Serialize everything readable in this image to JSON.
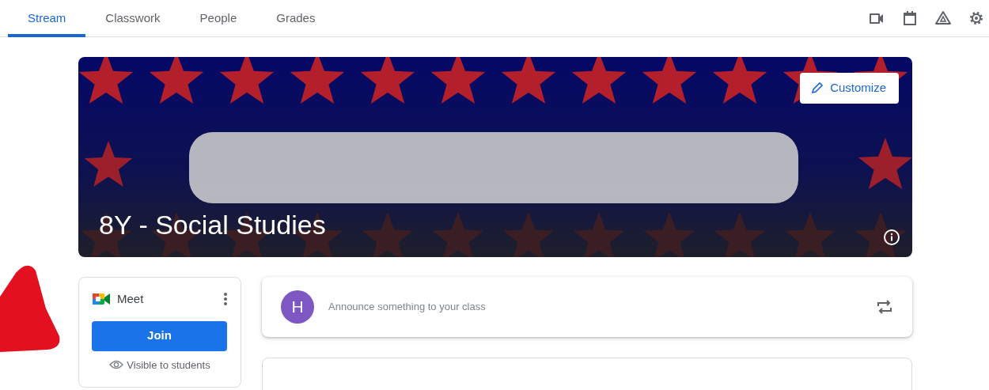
{
  "tabs": [
    {
      "label": "Stream",
      "selected": true
    },
    {
      "label": "Classwork",
      "selected": false
    },
    {
      "label": "People",
      "selected": false
    },
    {
      "label": "Grades",
      "selected": false
    }
  ],
  "toolbar": [
    {
      "kind": "video"
    },
    {
      "kind": "calendar"
    },
    {
      "kind": "drive"
    },
    {
      "kind": "settings"
    }
  ],
  "banner": {
    "kind": "picture",
    "customize_label": "Customize",
    "class_name": "8Y - Social Studies"
  },
  "meet": {
    "title": "Meet",
    "join_label": "Join",
    "visibility": "Visible to students"
  },
  "announce": {
    "avatar_letter": "H",
    "placeholder": "Announce something to your class"
  }
}
